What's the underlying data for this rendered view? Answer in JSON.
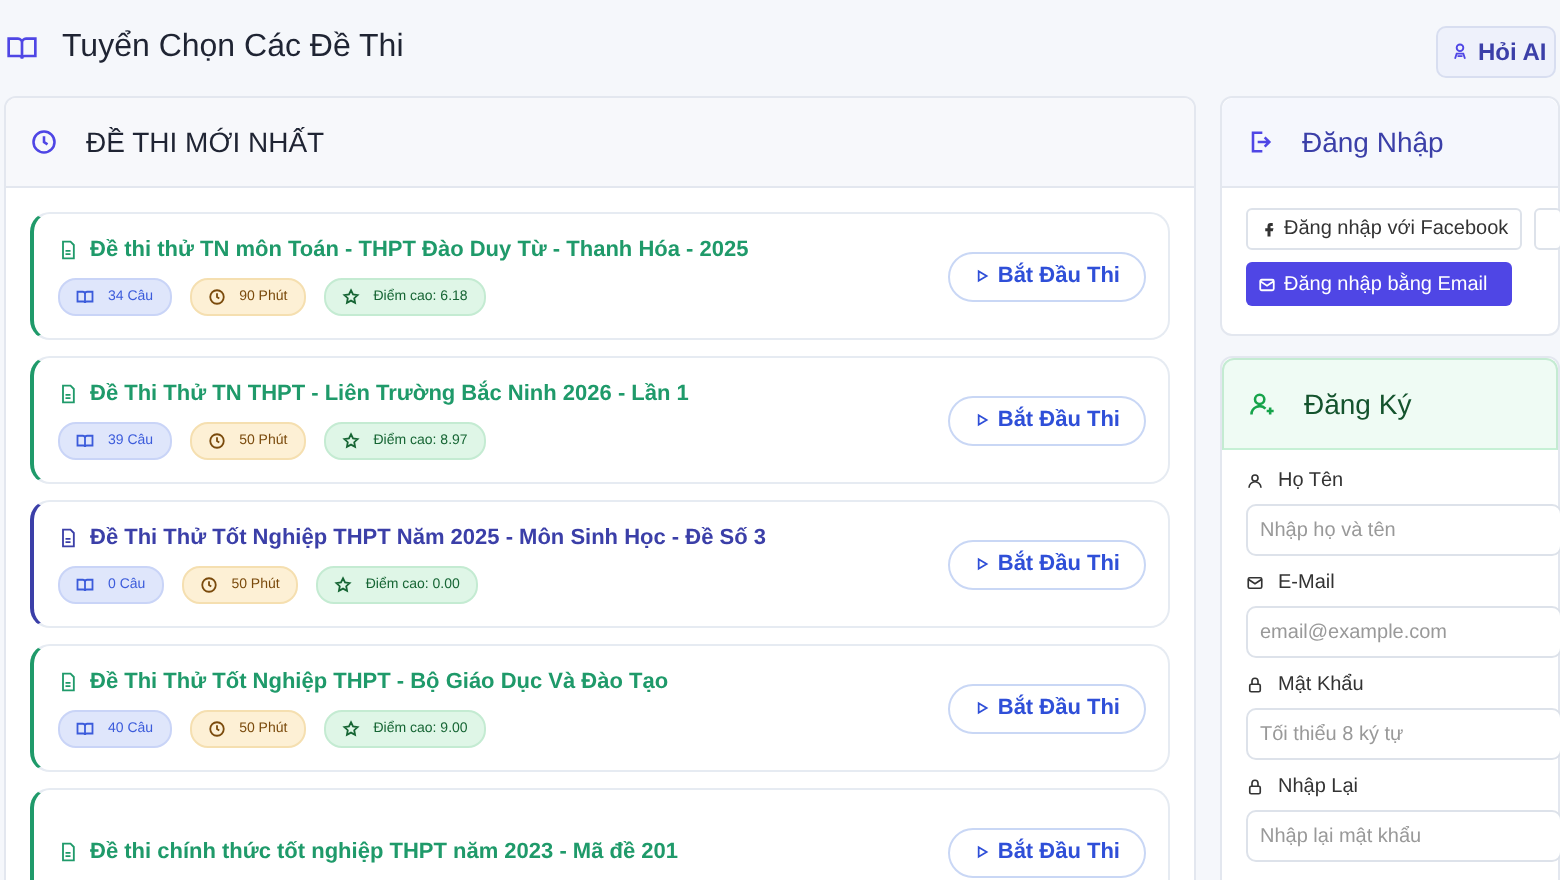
{
  "header": {
    "title": "Tuyển Chọn Các Đề Thi",
    "ask_button": "Hỏi AI"
  },
  "latest": {
    "title": "ĐỀ THI MỚI NHẤT",
    "exams": [
      {
        "title": "Đề thi thử TN môn Toán - THPT Đào Duy Từ - Thanh Hóa - 2025",
        "color": "#1f9a6a",
        "questions": "34 Câu",
        "duration": "90 Phút",
        "high_score": "Điểm cao: 6.18",
        "button": "Bắt Đầu Thi"
      },
      {
        "title": "Đề Thi Thử TN THPT - Liên Trường Bắc Ninh 2026 - Lần 1",
        "color": "#1f9a6a",
        "questions": "39 Câu",
        "duration": "50 Phút",
        "high_score": "Điểm cao: 8.97",
        "button": "Bắt Đầu Thi"
      },
      {
        "title": "Đề Thi Thử Tốt Nghiệp THPT Năm 2025 - Môn Sinh Học - Đề Số 3",
        "color": "#3b3fa8",
        "questions": "0 Câu",
        "duration": "50 Phút",
        "high_score": "Điểm cao: 0.00",
        "button": "Bắt Đầu Thi"
      },
      {
        "title": "Đề Thi Thử Tốt Nghiệp THPT - Bộ Giáo Dục Và Đào Tạo",
        "color": "#1f9a6a",
        "questions": "40 Câu",
        "duration": "50 Phút",
        "high_score": "Điểm cao: 9.00",
        "button": "Bắt Đầu Thi"
      },
      {
        "title": "Đề thi chính thức tốt nghiệp THPT năm 2023 - Mã đề 201",
        "color": "#1f9a6a",
        "button": "Bắt Đầu Thi"
      }
    ]
  },
  "login": {
    "title": "Đăng Nhập",
    "facebook_button": "Đăng nhập với Facebook",
    "email_button": "Đăng nhập bằng Email"
  },
  "register": {
    "title": "Đăng Ký",
    "fields": [
      {
        "kind": "person",
        "label": "Họ Tên",
        "placeholder": "Nhập họ và tên"
      },
      {
        "kind": "mail",
        "label": "E-Mail",
        "placeholder": "email@example.com"
      },
      {
        "kind": "lock",
        "label": "Mật Khẩu",
        "placeholder": "Tối thiểu 8 ký tự"
      },
      {
        "kind": "lock",
        "label": "Nhập Lại",
        "placeholder": "Nhập lại mật khẩu"
      }
    ]
  }
}
